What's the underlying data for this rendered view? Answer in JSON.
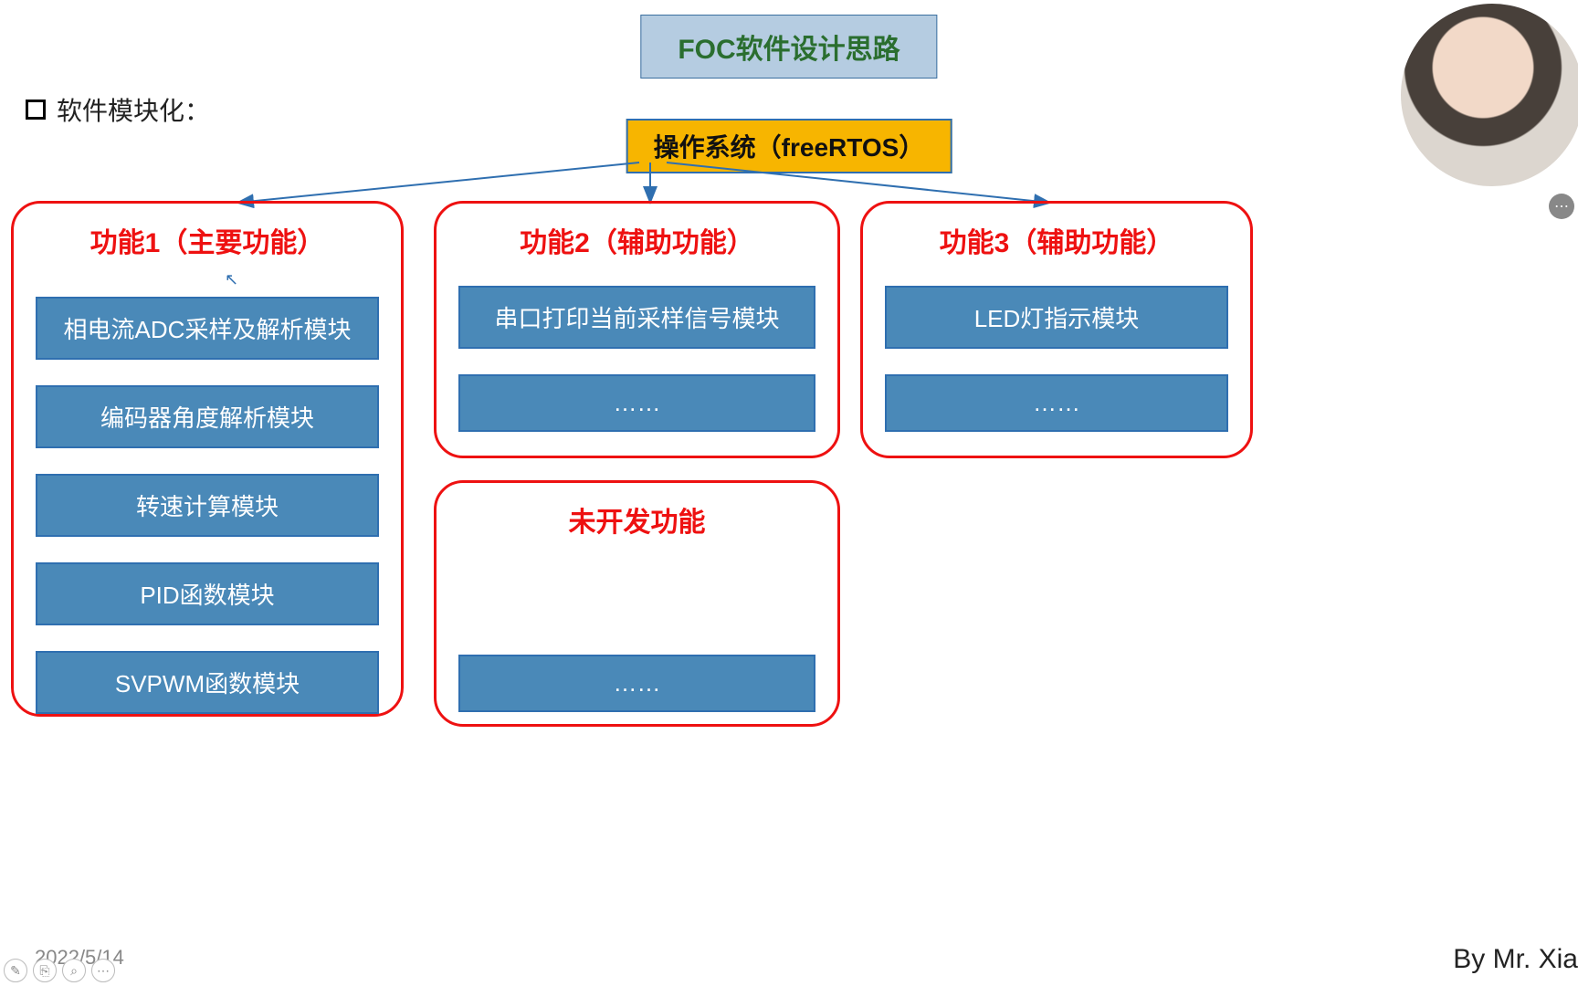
{
  "title": "FOC软件设计思路",
  "section_label": "软件模块化：",
  "os_box": "操作系统（freeRTOS）",
  "groups": {
    "g1": {
      "title": "功能1（主要功能）",
      "modules": [
        "相电流ADC采样及解析模块",
        "编码器角度解析模块",
        "转速计算模块",
        "PID函数模块",
        "SVPWM函数模块"
      ]
    },
    "g2": {
      "title": "功能2（辅助功能）",
      "modules": [
        "串口打印当前采样信号模块",
        "……"
      ]
    },
    "g3": {
      "title": "功能3（辅助功能）",
      "modules": [
        "LED灯指示模块",
        "……"
      ]
    },
    "g4": {
      "title": "未开发功能",
      "modules": [
        "……"
      ]
    }
  },
  "footer": {
    "date": "2022/5/14",
    "author": "By Mr. Xia"
  },
  "icons": {
    "more": "⋯",
    "pen": "✎",
    "copy": "⎘",
    "zoom": "⌕",
    "menu": "⋯"
  },
  "chart_data": {
    "type": "tree",
    "root": "操作系统（freeRTOS）",
    "children": [
      {
        "name": "功能1（主要功能）",
        "modules": [
          "相电流ADC采样及解析模块",
          "编码器角度解析模块",
          "转速计算模块",
          "PID函数模块",
          "SVPWM函数模块"
        ]
      },
      {
        "name": "功能2（辅助功能）",
        "modules": [
          "串口打印当前采样信号模块",
          "……"
        ]
      },
      {
        "name": "功能3（辅助功能）",
        "modules": [
          "LED灯指示模块",
          "……"
        ]
      },
      {
        "name": "未开发功能",
        "modules": [
          "……"
        ]
      }
    ]
  }
}
